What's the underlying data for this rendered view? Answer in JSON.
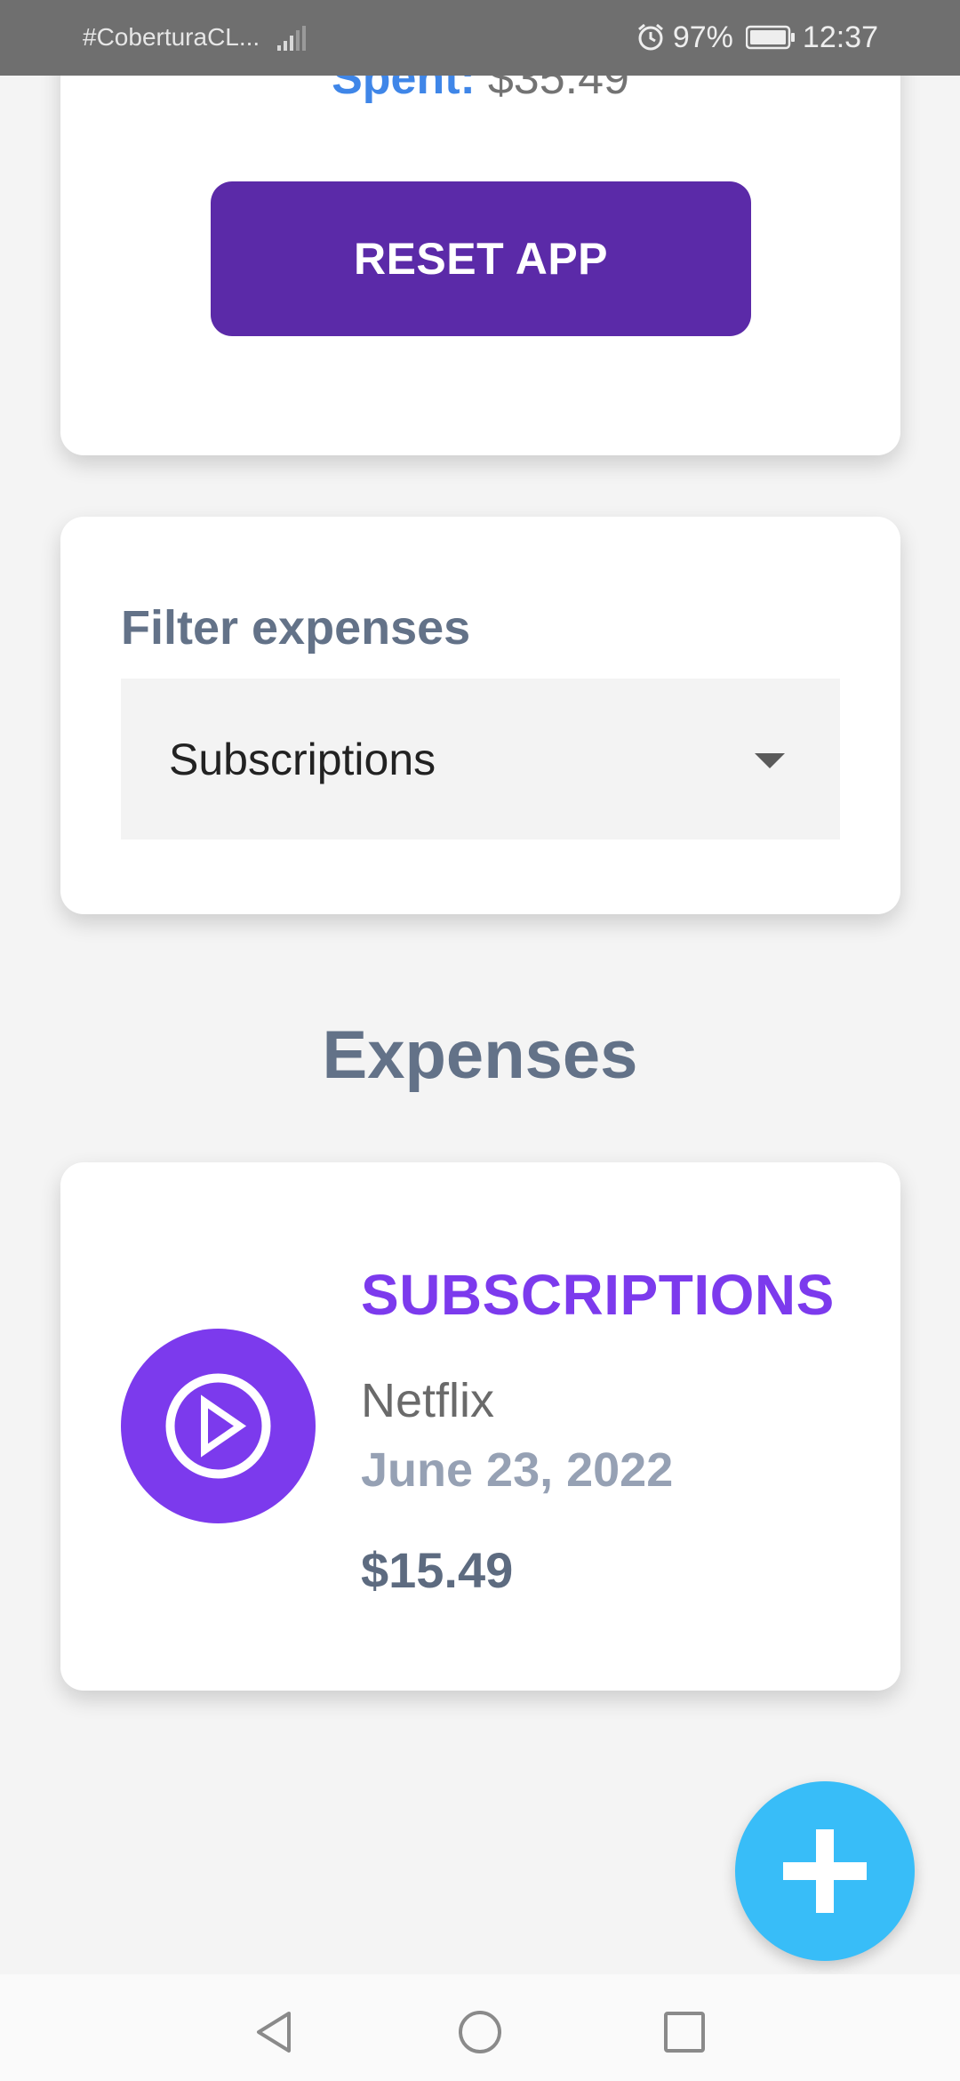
{
  "status_bar": {
    "carrier": "#CoberturaCL...",
    "battery": "97%",
    "time": "12:37"
  },
  "summary": {
    "spent_label": "Spent:",
    "spent_value": "$35.49",
    "reset_button": "RESET APP"
  },
  "filter": {
    "title": "Filter expenses",
    "selected": "Subscriptions"
  },
  "expenses": {
    "heading": "Expenses",
    "items": [
      {
        "category": "SUBSCRIPTIONS",
        "name": "Netflix",
        "date": "June 23, 2022",
        "amount": "$15.49",
        "icon": "play-circle-icon"
      }
    ]
  },
  "fab": {
    "icon": "plus-icon"
  },
  "navigation": {
    "icons": [
      "back-icon",
      "home-icon",
      "recents-icon"
    ]
  },
  "colors": {
    "primary_purple": "#5b2aa8",
    "category_purple": "#7c3aed",
    "accent_blue": "#3f86e8",
    "fab_blue": "#38bdf8",
    "heading_slate": "#637288"
  }
}
